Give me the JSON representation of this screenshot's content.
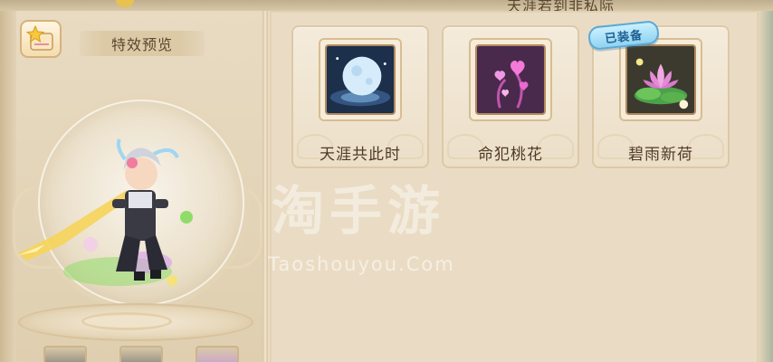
{
  "header": {
    "top_text": "天涯若到非私际"
  },
  "preview": {
    "title": "特效预览"
  },
  "effects": [
    {
      "name": "天涯共此时",
      "icon": "moon-orb-icon",
      "equipped": false
    },
    {
      "name": "命犯桃花",
      "icon": "pink-hearts-icon",
      "equipped": false
    },
    {
      "name": "碧雨新荷",
      "icon": "lotus-icon",
      "equipped": true
    }
  ],
  "badge": {
    "equipped_label": "已装备"
  },
  "watermark": {
    "main": "淘手游",
    "sub": "Taoshouyou.Com"
  },
  "colors": {
    "panel_bg": "#eadcc4",
    "card_bg": "#f4ebdb",
    "text": "#4e3a27",
    "badge_blue": "#8fd3f1"
  }
}
